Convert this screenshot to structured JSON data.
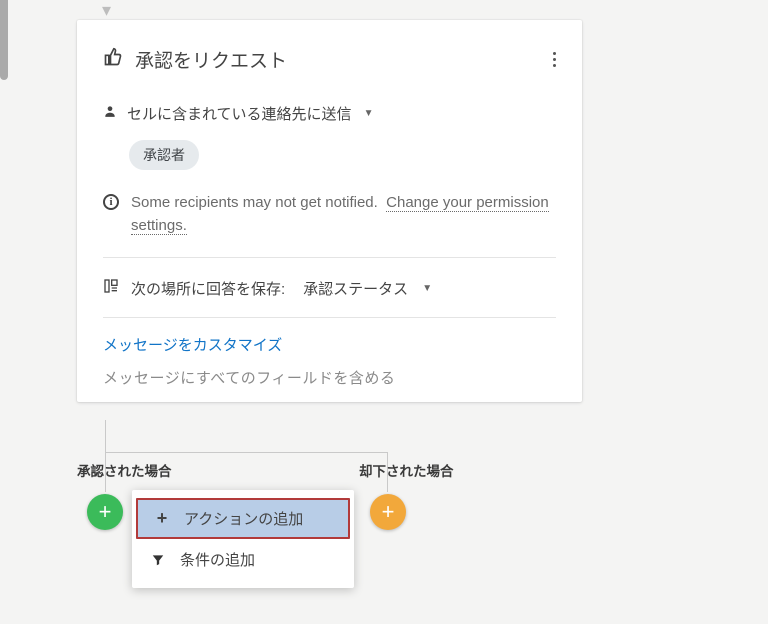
{
  "card": {
    "title": "承認をリクエスト",
    "send_label": "セルに含まれている連絡先に送信",
    "approver_chip": "承認者",
    "info_prefix": "Some recipients may not get notified.",
    "info_link": "Change your permission settings.",
    "save_label": "次の場所に回答を保存:",
    "save_value": "承認ステータス",
    "customize_link": "メッセージをカスタマイズ",
    "include_all": "メッセージにすべてのフィールドを含める"
  },
  "branches": {
    "approved": "承認された場合",
    "rejected": "却下された場合"
  },
  "menu": {
    "add_action": "アクションの追加",
    "add_condition": "条件の追加"
  }
}
